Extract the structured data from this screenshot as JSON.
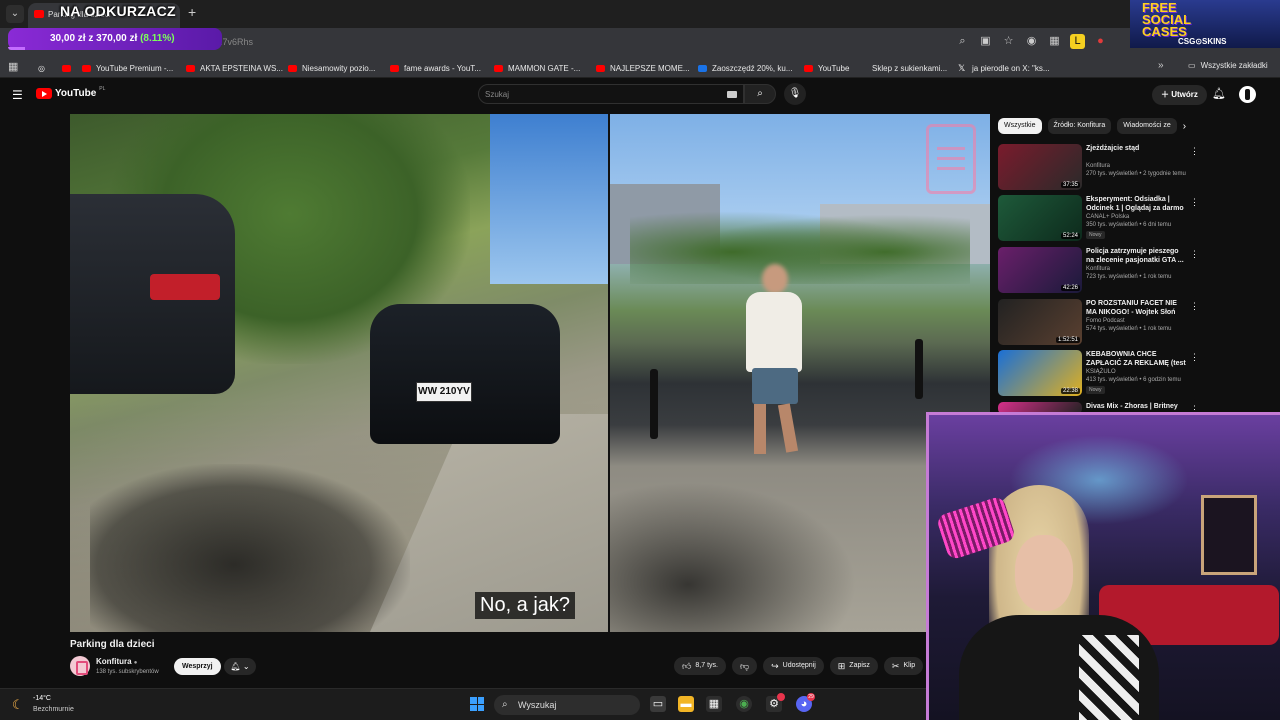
{
  "browser": {
    "tab_title": "Parking dla dzieci",
    "url_fragment": "...7v6Rhs",
    "bookmarks": [
      {
        "label": "YouTube Premium -...",
        "icon": "youtube-icon"
      },
      {
        "label": "AKTA EPSTEINA WS...",
        "icon": "youtube-icon"
      },
      {
        "label": "Niesamowity pozio...",
        "icon": "youtube-icon"
      },
      {
        "label": "fame awards - YouT...",
        "icon": "youtube-icon"
      },
      {
        "label": "MAMMON GATE -...",
        "icon": "youtube-icon"
      },
      {
        "label": "NAJLEPSZE MOME...",
        "icon": "youtube-icon"
      },
      {
        "label": "Zaoszczędź 20%, ku...",
        "icon": "bluesky-icon"
      },
      {
        "label": "YouTube",
        "icon": "youtube-icon"
      },
      {
        "label": "Sklep z sukienkami...",
        "icon": "shop-icon"
      },
      {
        "label": "ja pierodle on X: \"ks...",
        "icon": "x-icon"
      }
    ],
    "all_bookmarks": "Wszystkie zakładki"
  },
  "stream_overlay": {
    "title": "NA ODKURZACZ",
    "goal_current": "30,00 zł",
    "goal_sep": "z",
    "goal_target": "370,00 zł",
    "goal_percent": "(8.11%)",
    "goal_fraction": 0.0811,
    "promo_line1": "FREE",
    "promo_line2": "SOCIAL",
    "promo_line3": "CASES",
    "promo_brand": "CSG⊙SKINS"
  },
  "youtube": {
    "logo": "YouTube",
    "logo_region": "PL",
    "search_placeholder": "Szukaj",
    "create_label": "Utwórz",
    "video": {
      "title": "Parking dla dzieci",
      "subtitle": "No, a jak?",
      "plate": "WW 210YV",
      "channel": "Konfitura",
      "subscribers": "138 tys. subskrybentów",
      "support_label": "Wesprzyj",
      "likes": "8,7 tys.",
      "share_label": "Udostępnij",
      "save_label": "Zapisz",
      "clip_label": "Klip"
    },
    "chips": [
      "Wszystkie",
      "Źródło: Konfitura",
      "Wiadomości ze"
    ],
    "related": [
      {
        "title": "Zjeżdżajcie stąd",
        "channel": "Konfitura",
        "meta": "270 tys. wyświetleń • 2 tygodnie temu",
        "duration": "37:35",
        "badge": ""
      },
      {
        "title": "Eksperyment: Odsiadka | Odcinek 1 | Oglądaj za darmo",
        "channel": "CANAL+ Polska",
        "meta": "350 tys. wyświetleń • 6 dni temu",
        "duration": "52:24",
        "badge": "Nowy"
      },
      {
        "title": "Policja zatrzymuje pieszego na zlecenie pasjonatki GTA ...",
        "channel": "Konfitura",
        "meta": "723 tys. wyświetleń • 1 rok temu",
        "duration": "42:26",
        "badge": ""
      },
      {
        "title": "PO ROZSTANIU FACET NIE MA NIKOGO! - Wojtek Słoń",
        "channel": "Fomo Podcast",
        "meta": "574 tys. wyświetleń • 1 rok temu",
        "duration": "1:52:51",
        "badge": ""
      },
      {
        "title": "KEBABOWNIA CHCE ZAPŁACIĆ ZA REKLAMĘ (test incognito, ...",
        "channel": "KSIĄŻULO",
        "meta": "413 tys. wyświetleń • 6 godzin temu",
        "duration": "22:38",
        "badge": "Nowy"
      },
      {
        "title": "Divas Mix - Zhoras | Britney",
        "channel": "",
        "meta": "",
        "duration": "",
        "badge": ""
      }
    ]
  },
  "taskbar": {
    "temperature": "-14°C",
    "weather": "Bezchmurnie",
    "search_placeholder": "Wyszukaj",
    "discord_badge": "29"
  },
  "colors": {
    "yt_red": "#ff0000",
    "overlay_purple": "#8a2ad6",
    "goal_green": "#7cff5a",
    "promo_yellow": "#ffd21e"
  }
}
